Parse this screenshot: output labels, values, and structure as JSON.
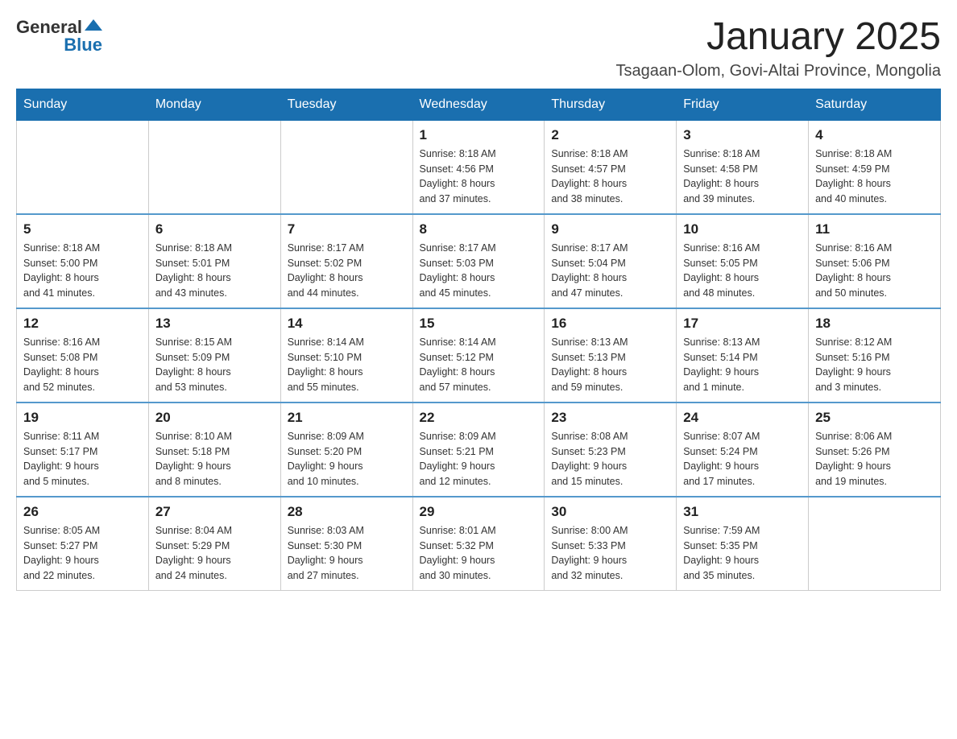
{
  "logo": {
    "general": "General",
    "blue": "Blue"
  },
  "title": "January 2025",
  "location": "Tsagaan-Olom, Govi-Altai Province, Mongolia",
  "days_of_week": [
    "Sunday",
    "Monday",
    "Tuesday",
    "Wednesday",
    "Thursday",
    "Friday",
    "Saturday"
  ],
  "weeks": [
    [
      {
        "day": "",
        "info": ""
      },
      {
        "day": "",
        "info": ""
      },
      {
        "day": "",
        "info": ""
      },
      {
        "day": "1",
        "info": "Sunrise: 8:18 AM\nSunset: 4:56 PM\nDaylight: 8 hours\nand 37 minutes."
      },
      {
        "day": "2",
        "info": "Sunrise: 8:18 AM\nSunset: 4:57 PM\nDaylight: 8 hours\nand 38 minutes."
      },
      {
        "day": "3",
        "info": "Sunrise: 8:18 AM\nSunset: 4:58 PM\nDaylight: 8 hours\nand 39 minutes."
      },
      {
        "day": "4",
        "info": "Sunrise: 8:18 AM\nSunset: 4:59 PM\nDaylight: 8 hours\nand 40 minutes."
      }
    ],
    [
      {
        "day": "5",
        "info": "Sunrise: 8:18 AM\nSunset: 5:00 PM\nDaylight: 8 hours\nand 41 minutes."
      },
      {
        "day": "6",
        "info": "Sunrise: 8:18 AM\nSunset: 5:01 PM\nDaylight: 8 hours\nand 43 minutes."
      },
      {
        "day": "7",
        "info": "Sunrise: 8:17 AM\nSunset: 5:02 PM\nDaylight: 8 hours\nand 44 minutes."
      },
      {
        "day": "8",
        "info": "Sunrise: 8:17 AM\nSunset: 5:03 PM\nDaylight: 8 hours\nand 45 minutes."
      },
      {
        "day": "9",
        "info": "Sunrise: 8:17 AM\nSunset: 5:04 PM\nDaylight: 8 hours\nand 47 minutes."
      },
      {
        "day": "10",
        "info": "Sunrise: 8:16 AM\nSunset: 5:05 PM\nDaylight: 8 hours\nand 48 minutes."
      },
      {
        "day": "11",
        "info": "Sunrise: 8:16 AM\nSunset: 5:06 PM\nDaylight: 8 hours\nand 50 minutes."
      }
    ],
    [
      {
        "day": "12",
        "info": "Sunrise: 8:16 AM\nSunset: 5:08 PM\nDaylight: 8 hours\nand 52 minutes."
      },
      {
        "day": "13",
        "info": "Sunrise: 8:15 AM\nSunset: 5:09 PM\nDaylight: 8 hours\nand 53 minutes."
      },
      {
        "day": "14",
        "info": "Sunrise: 8:14 AM\nSunset: 5:10 PM\nDaylight: 8 hours\nand 55 minutes."
      },
      {
        "day": "15",
        "info": "Sunrise: 8:14 AM\nSunset: 5:12 PM\nDaylight: 8 hours\nand 57 minutes."
      },
      {
        "day": "16",
        "info": "Sunrise: 8:13 AM\nSunset: 5:13 PM\nDaylight: 8 hours\nand 59 minutes."
      },
      {
        "day": "17",
        "info": "Sunrise: 8:13 AM\nSunset: 5:14 PM\nDaylight: 9 hours\nand 1 minute."
      },
      {
        "day": "18",
        "info": "Sunrise: 8:12 AM\nSunset: 5:16 PM\nDaylight: 9 hours\nand 3 minutes."
      }
    ],
    [
      {
        "day": "19",
        "info": "Sunrise: 8:11 AM\nSunset: 5:17 PM\nDaylight: 9 hours\nand 5 minutes."
      },
      {
        "day": "20",
        "info": "Sunrise: 8:10 AM\nSunset: 5:18 PM\nDaylight: 9 hours\nand 8 minutes."
      },
      {
        "day": "21",
        "info": "Sunrise: 8:09 AM\nSunset: 5:20 PM\nDaylight: 9 hours\nand 10 minutes."
      },
      {
        "day": "22",
        "info": "Sunrise: 8:09 AM\nSunset: 5:21 PM\nDaylight: 9 hours\nand 12 minutes."
      },
      {
        "day": "23",
        "info": "Sunrise: 8:08 AM\nSunset: 5:23 PM\nDaylight: 9 hours\nand 15 minutes."
      },
      {
        "day": "24",
        "info": "Sunrise: 8:07 AM\nSunset: 5:24 PM\nDaylight: 9 hours\nand 17 minutes."
      },
      {
        "day": "25",
        "info": "Sunrise: 8:06 AM\nSunset: 5:26 PM\nDaylight: 9 hours\nand 19 minutes."
      }
    ],
    [
      {
        "day": "26",
        "info": "Sunrise: 8:05 AM\nSunset: 5:27 PM\nDaylight: 9 hours\nand 22 minutes."
      },
      {
        "day": "27",
        "info": "Sunrise: 8:04 AM\nSunset: 5:29 PM\nDaylight: 9 hours\nand 24 minutes."
      },
      {
        "day": "28",
        "info": "Sunrise: 8:03 AM\nSunset: 5:30 PM\nDaylight: 9 hours\nand 27 minutes."
      },
      {
        "day": "29",
        "info": "Sunrise: 8:01 AM\nSunset: 5:32 PM\nDaylight: 9 hours\nand 30 minutes."
      },
      {
        "day": "30",
        "info": "Sunrise: 8:00 AM\nSunset: 5:33 PM\nDaylight: 9 hours\nand 32 minutes."
      },
      {
        "day": "31",
        "info": "Sunrise: 7:59 AM\nSunset: 5:35 PM\nDaylight: 9 hours\nand 35 minutes."
      },
      {
        "day": "",
        "info": ""
      }
    ]
  ]
}
